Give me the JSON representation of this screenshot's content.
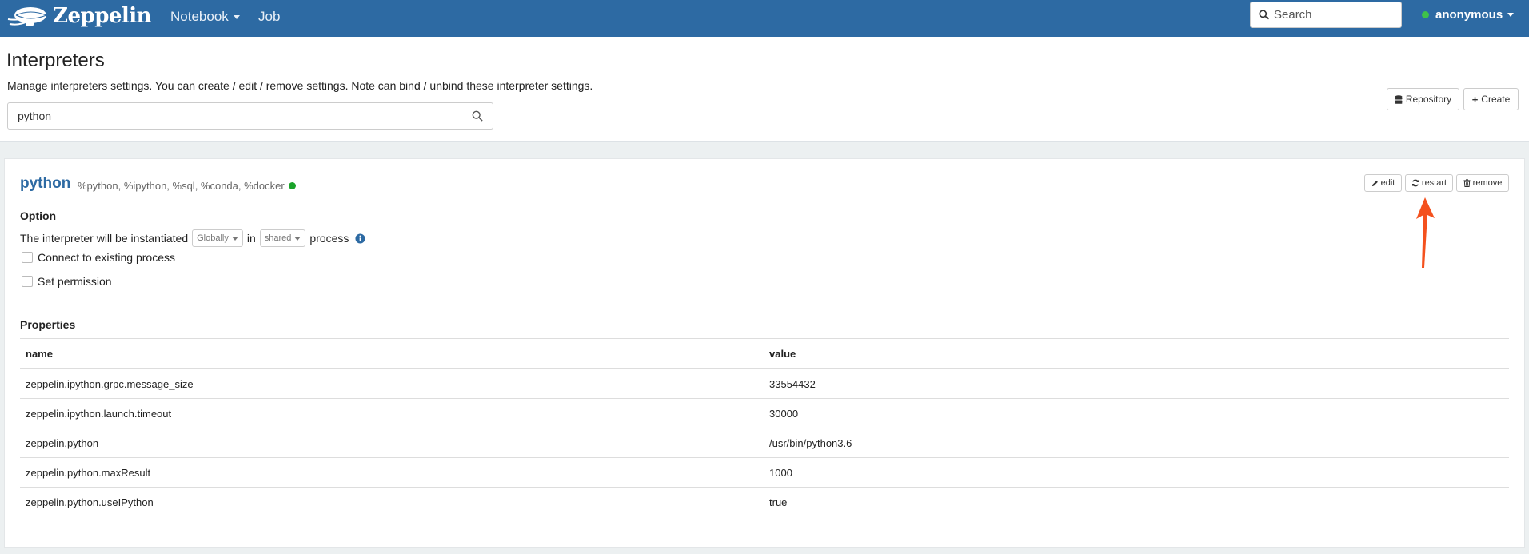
{
  "app": {
    "brand": "Zeppelin",
    "nav": {
      "notebook": "Notebook",
      "job": "Job"
    },
    "search_placeholder": "Search",
    "user": "anonymous"
  },
  "page": {
    "title": "Interpreters",
    "description": "Manage interpreters settings. You can create / edit / remove settings. Note can bind / unbind these interpreter settings.",
    "filter_value": "python",
    "repository_label": "Repository",
    "create_label": "Create"
  },
  "interpreter": {
    "name": "python",
    "aliases": "%python, %ipython, %sql, %conda, %docker",
    "status_color": "#1aa32a",
    "buttons": {
      "edit": "edit",
      "restart": "restart",
      "remove": "remove"
    },
    "option": {
      "heading": "Option",
      "prefix": "The interpreter will be instantiated",
      "scope": "Globally",
      "in_text": "in",
      "mode": "shared",
      "suffix": "process",
      "connect_existing": "Connect to existing process",
      "set_permission": "Set permission"
    },
    "properties": {
      "heading": "Properties",
      "columns": [
        "name",
        "value"
      ],
      "rows": [
        [
          "zeppelin.ipython.grpc.message_size",
          "33554432"
        ],
        [
          "zeppelin.ipython.launch.timeout",
          "30000"
        ],
        [
          "zeppelin.python",
          "/usr/bin/python3.6"
        ],
        [
          "zeppelin.python.maxResult",
          "1000"
        ],
        [
          "zeppelin.python.useIPython",
          "true"
        ]
      ]
    }
  },
  "colors": {
    "navbar": "#2d6aa3",
    "accent": "#2d6aa3",
    "annotation_arrow": "#f4511e",
    "online": "#3fc14a"
  }
}
